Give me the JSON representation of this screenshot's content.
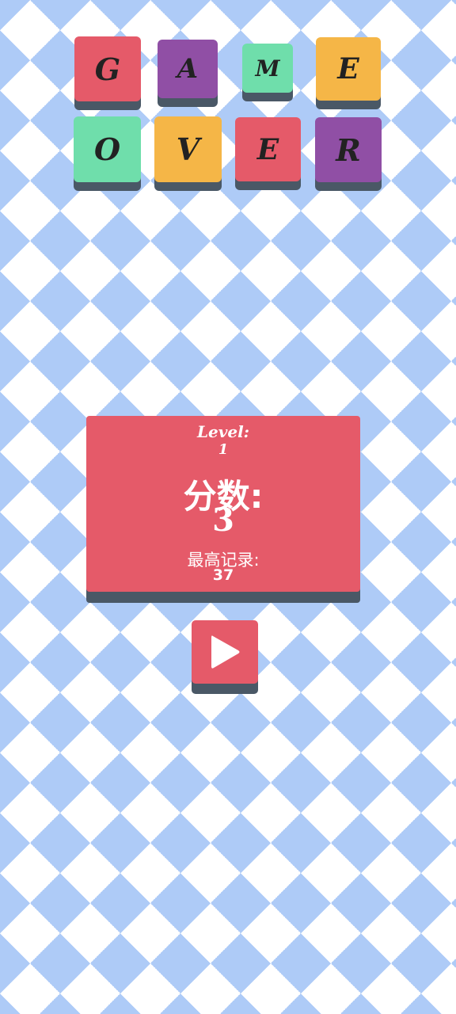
{
  "title_tiles": [
    {
      "letter": "G",
      "color": "#e55a69"
    },
    {
      "letter": "A",
      "color": "#904fa5"
    },
    {
      "letter": "M",
      "color": "#6fdeab"
    },
    {
      "letter": "E",
      "color": "#f5b647"
    },
    {
      "letter": "O",
      "color": "#6fdeab"
    },
    {
      "letter": "V",
      "color": "#f5b647"
    },
    {
      "letter": "E",
      "color": "#e55a69"
    },
    {
      "letter": "R",
      "color": "#904fa5"
    }
  ],
  "result": {
    "level_label": "Level:",
    "level_value": "1",
    "score_label": "分数:",
    "score_value": "3",
    "best_label": "最高记录:",
    "best_value": "37"
  },
  "play_button": {
    "icon": "play-icon",
    "color": "#e55a69"
  },
  "colors": {
    "background_light": "#ffffff",
    "background_pattern": "#aecbf7",
    "shadow": "#4a5866"
  }
}
